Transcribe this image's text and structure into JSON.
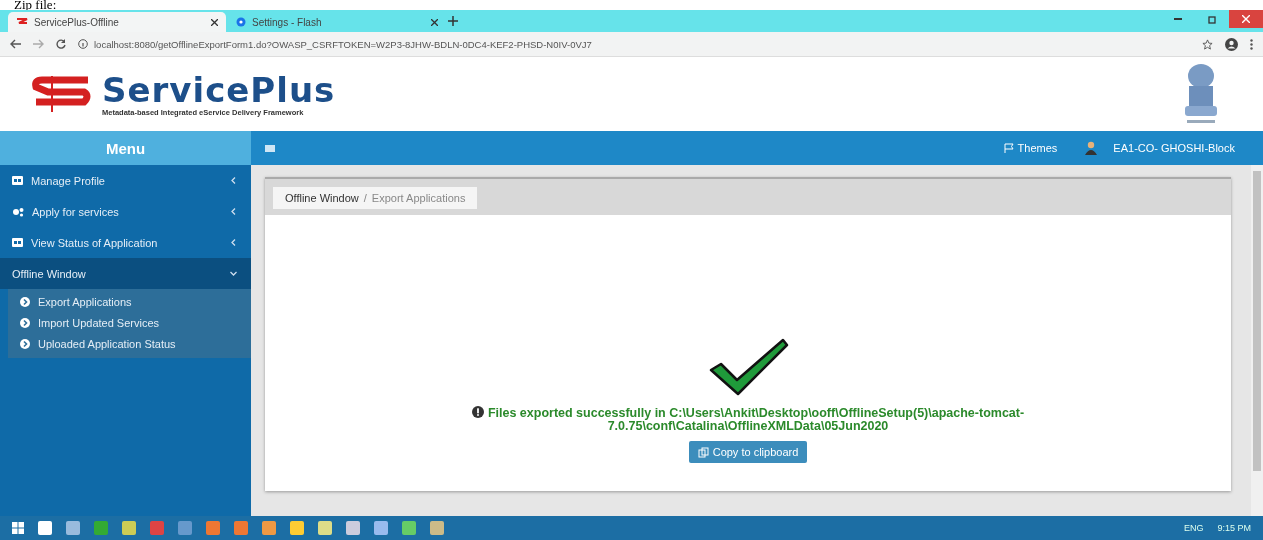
{
  "document_caption": "Zip file:",
  "browser": {
    "tabs": [
      {
        "title": "ServicePlus-Offline",
        "selected": true
      },
      {
        "title": "Settings - Flash",
        "selected": false
      }
    ],
    "url": "localhost:8080/getOfflineExportForm1.do?OWASP_CSRFTOKEN=W2P3-8JHW-BDLN-0DC4-KEF2-PHSD-N0IV-0VJ7"
  },
  "header": {
    "logo_text": "ServicePlus",
    "tagline": "Metadata-based Integrated eService Delivery Framework"
  },
  "navbar": {
    "menu_title": "Menu",
    "themes": "Themes",
    "user": "EA1-CO- GHOSHI-Block"
  },
  "sidebar": {
    "items": [
      {
        "label": "Manage Profile",
        "expanded": false
      },
      {
        "label": "Apply for services",
        "expanded": false
      },
      {
        "label": "View Status of Application",
        "expanded": false
      },
      {
        "label": "Offline Window",
        "expanded": true,
        "children": [
          "Export Applications",
          "Import Updated Services",
          "Uploaded Application Status"
        ]
      }
    ]
  },
  "breadcrumb": [
    "Offline Window",
    "Export Applications"
  ],
  "breadcrumb_separator": "/",
  "message": {
    "text": "Files exported successfully in C:\\Users\\Ankit\\Desktop\\ooff\\OfflineSetup(5)\\apache-tomcat-7.0.75\\conf\\Catalina\\OfflineXMLData\\05Jun2020",
    "button": "Copy to clipboard"
  },
  "taskbar": {
    "language": "ENG",
    "time": "9:15 PM"
  }
}
